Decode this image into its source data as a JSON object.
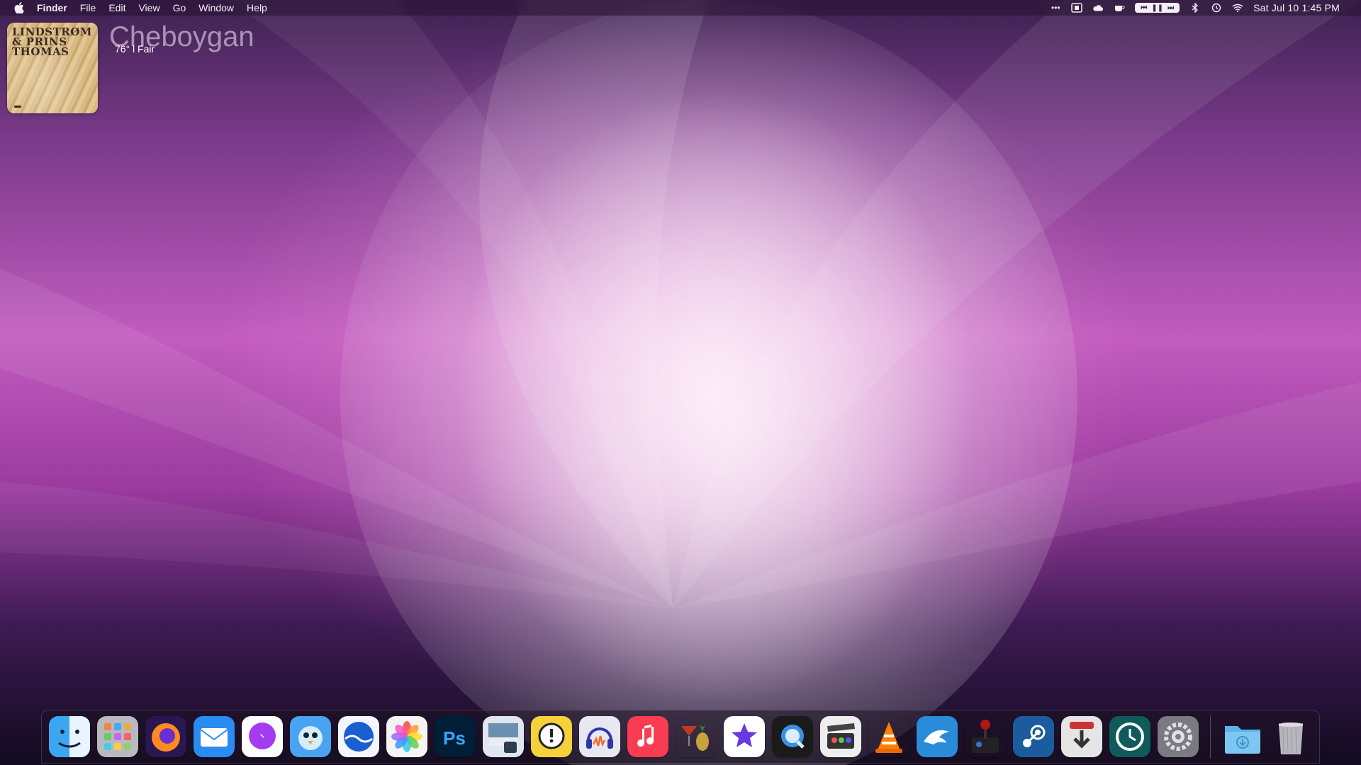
{
  "menubar": {
    "apple_icon": "apple-icon",
    "app_name": "Finder",
    "menus": [
      "File",
      "Edit",
      "View",
      "Go",
      "Window",
      "Help"
    ],
    "status_icons": [
      "more-icon",
      "screenshot-icon",
      "cloud-icon",
      "coffee-icon",
      "bluetooth-icon",
      "time-machine-icon",
      "wifi-icon"
    ],
    "media_controls": [
      "previous-track",
      "pause",
      "next-track"
    ],
    "clock": "Sat Jul 10  1:45 PM"
  },
  "widgets": {
    "album": {
      "artist": "LINDSTRØM & PRINS THOMAS"
    },
    "weather": {
      "city": "Cheboygan",
      "condition": "76° l Fair"
    }
  },
  "dock": {
    "apps": [
      {
        "name": "finder",
        "icon": "finder-icon",
        "color": "#3aa7f0"
      },
      {
        "name": "launchpad",
        "icon": "launchpad-icon",
        "color": "#b9b9c0"
      },
      {
        "name": "firefox",
        "icon": "firefox-icon",
        "color": "#ff8a1f"
      },
      {
        "name": "mail",
        "icon": "mail-icon",
        "color": "#2a8cf2"
      },
      {
        "name": "messenger",
        "icon": "messenger-icon",
        "color": "#a33cf0"
      },
      {
        "name": "tweetbot",
        "icon": "bird-icon",
        "color": "#4aa3f0"
      },
      {
        "name": "mercury",
        "icon": "wave-icon",
        "color": "#1a5fd0"
      },
      {
        "name": "photos",
        "icon": "photos-icon",
        "color": "#f4f4f4"
      },
      {
        "name": "photoshop",
        "icon": "photoshop-icon",
        "color": "#001e36"
      },
      {
        "name": "preview",
        "icon": "preview-icon",
        "color": "#6b8fb0"
      },
      {
        "name": "alert",
        "icon": "exclamation-bubble-icon",
        "color": "#f6d23a"
      },
      {
        "name": "audacity",
        "icon": "headphones-icon",
        "color": "#e8e8f2"
      },
      {
        "name": "music",
        "icon": "music-note-icon",
        "color": "#fa3c52"
      },
      {
        "name": "cocktail",
        "icon": "cocktail-icon",
        "color": "#c0392b"
      },
      {
        "name": "imovie",
        "icon": "star-camera-icon",
        "color": "#ffffff"
      },
      {
        "name": "quicktime",
        "icon": "quicktime-icon",
        "color": "#1a1a1a"
      },
      {
        "name": "claquette",
        "icon": "clapper-icon",
        "color": "#eeeeee"
      },
      {
        "name": "vlc",
        "icon": "vlc-cone-icon",
        "color": "#ff7f00"
      },
      {
        "name": "dolphin",
        "icon": "dolphin-icon",
        "color": "#2a8cd9"
      },
      {
        "name": "joystick",
        "icon": "joystick-icon",
        "color": "#b01818"
      },
      {
        "name": "steam",
        "icon": "steam-icon",
        "color": "#1b5c9e"
      },
      {
        "name": "downie",
        "icon": "download-arrow-icon",
        "color": "#e5e5e5"
      },
      {
        "name": "time-machine",
        "icon": "clock-icon",
        "color": "#0f5a5a"
      },
      {
        "name": "system-preferences",
        "icon": "gear-icon",
        "color": "#7a7a80"
      }
    ],
    "folders": [
      {
        "name": "downloads",
        "icon": "downloads-folder-icon",
        "color": "#5ab4ea"
      },
      {
        "name": "trash",
        "icon": "trash-icon",
        "color": "#c9c9cf"
      }
    ]
  }
}
